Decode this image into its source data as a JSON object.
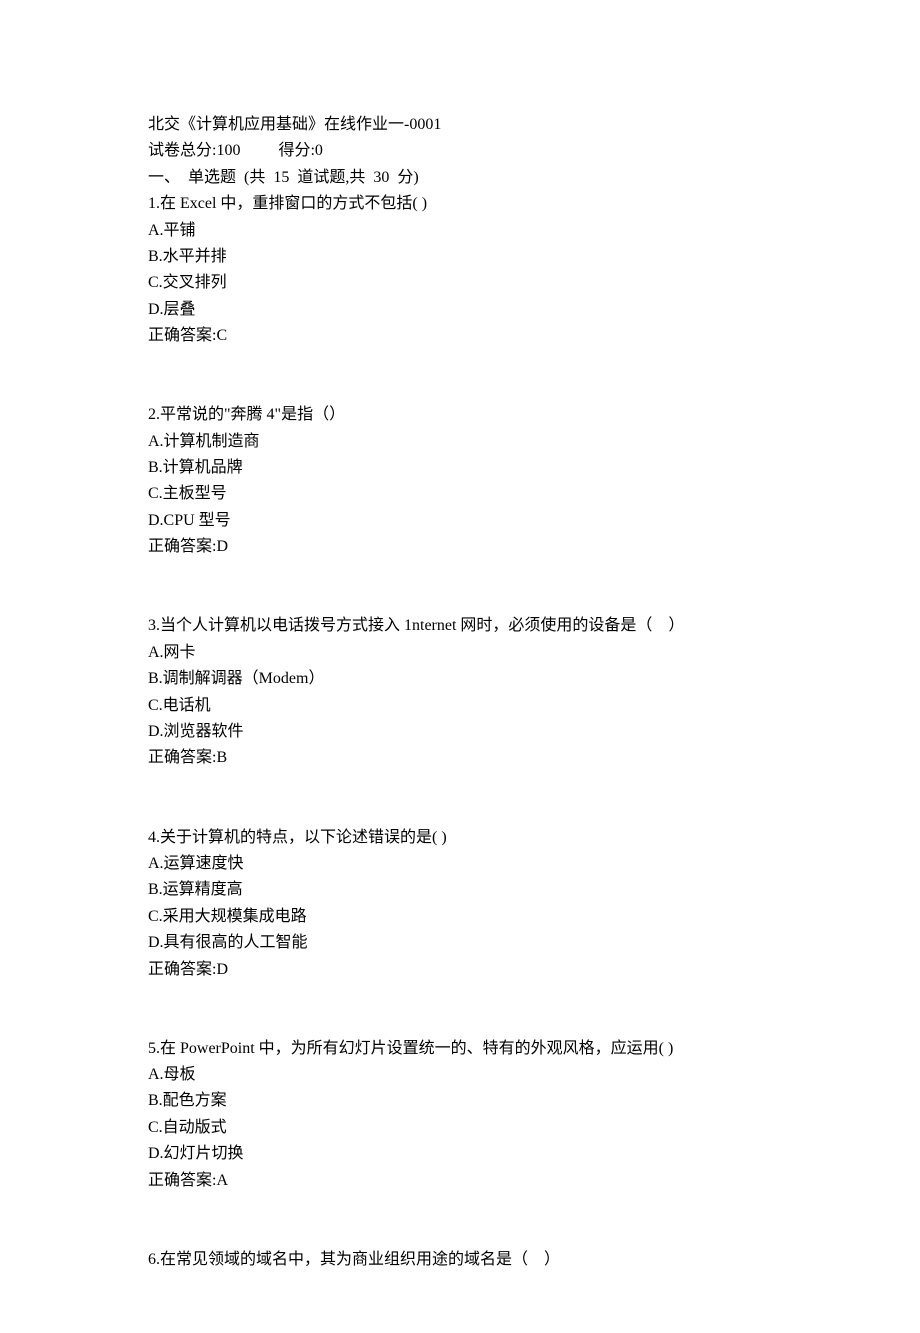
{
  "header": {
    "title": "北交《计算机应用基础》在线作业一-0001",
    "total_label": "试卷总分:",
    "total_value": "100",
    "score_label": "得分:",
    "score_value": "0",
    "section": "一、  单选题  (共  15  道试题,共  30  分)"
  },
  "questions": [
    {
      "q": "1.在 Excel 中，重排窗口的方式不包括( )",
      "opts": [
        "A.平铺",
        "B.水平并排",
        "C.交叉排列",
        "D.层叠"
      ],
      "ans": "正确答案:C"
    },
    {
      "q": "2.平常说的\"奔腾 4\"是指（）",
      "opts": [
        "A.计算机制造商",
        "B.计算机品牌",
        "C.主板型号",
        "D.CPU 型号"
      ],
      "ans": "正确答案:D"
    },
    {
      "q": "3.当个人计算机以电话拨号方式接入 1nternet 网时，必须使用的设备是（    ）",
      "opts": [
        "A.网卡",
        "B.调制解调器（Modem）",
        "C.电话机",
        "D.浏览器软件"
      ],
      "ans": "正确答案:B"
    },
    {
      "q": "4.关于计算机的特点，以下论述错误的是( )",
      "opts": [
        "A.运算速度快",
        "B.运算精度高",
        "C.采用大规模集成电路",
        "D.具有很高的人工智能"
      ],
      "ans": "正确答案:D"
    },
    {
      "q": "5.在 PowerPoint 中，为所有幻灯片设置统一的、特有的外观风格，应运用( )",
      "opts": [
        "A.母板",
        "B.配色方案",
        "C.自动版式",
        "D.幻灯片切换"
      ],
      "ans": "正确答案:A"
    },
    {
      "q": "6.在常见领域的域名中，其为商业组织用途的域名是（    ）",
      "opts": [],
      "ans": ""
    }
  ]
}
